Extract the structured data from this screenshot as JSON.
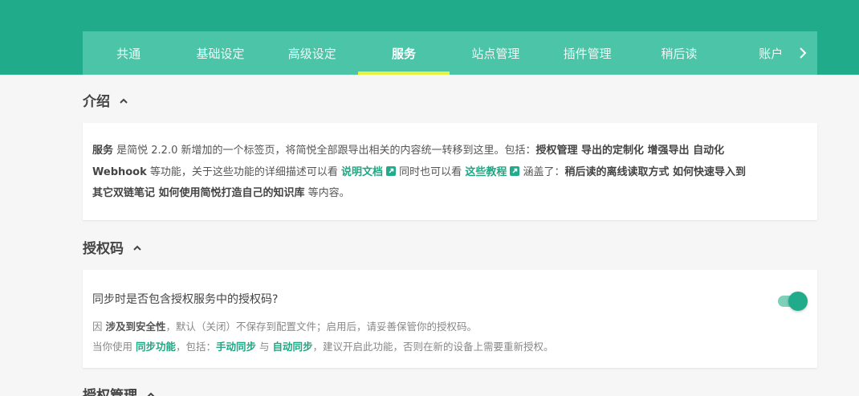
{
  "colors": {
    "primary": "#20ab8b",
    "tabbar": "#4cc4a8",
    "active_underline": "#e6f23c",
    "link": "#20a683"
  },
  "tabs": [
    {
      "label": "共通"
    },
    {
      "label": "基础设定"
    },
    {
      "label": "高级设定"
    },
    {
      "label": "服务",
      "active": true
    },
    {
      "label": "站点管理"
    },
    {
      "label": "插件管理"
    },
    {
      "label": "稍后读"
    },
    {
      "label": "账户"
    }
  ],
  "tab_next_icon": "chevron-right-icon",
  "sections": {
    "intro": {
      "title": "介绍",
      "t1": "服务",
      "t2": " 是简悦 2.2.0 新增加的一个标签页，将简悦全部跟导出相关的内容统一转移到这里。包括：",
      "t3": "授权管理 导出的定制化 增强导出 自动化",
      "t4": "Webhook",
      "t5": " 等功能，关于这些功能的详细描述可以看 ",
      "link1": "说明文档",
      "t6": " 同时也可以看 ",
      "link2": "这些教程",
      "t7": " 涵盖了：",
      "t8": "稍后读的离线读取方式 如何快速导入到",
      "t9": "其它双链笔记 如何使用简悦打造自己的知识库",
      "t10": " 等内容。"
    },
    "auth_code": {
      "title": "授权码",
      "question": "同步时是否包含授权服务中的授权码?",
      "toggle_on": true,
      "d1": "因 ",
      "d2": "涉及到安全性",
      "d3": "，默认（关闭）不保存到配置文件；启用后，请妥善保管你的授权码。",
      "d4": "当你使用 ",
      "d5": "同步功能",
      "d6": "，包括：",
      "d7": "手动同步",
      "d8": " 与 ",
      "d9": "自动同步",
      "d10": "，建议开启此功能，否则在新的设备上需要重新授权。"
    },
    "auth_manage": {
      "title": "授权管理"
    }
  }
}
